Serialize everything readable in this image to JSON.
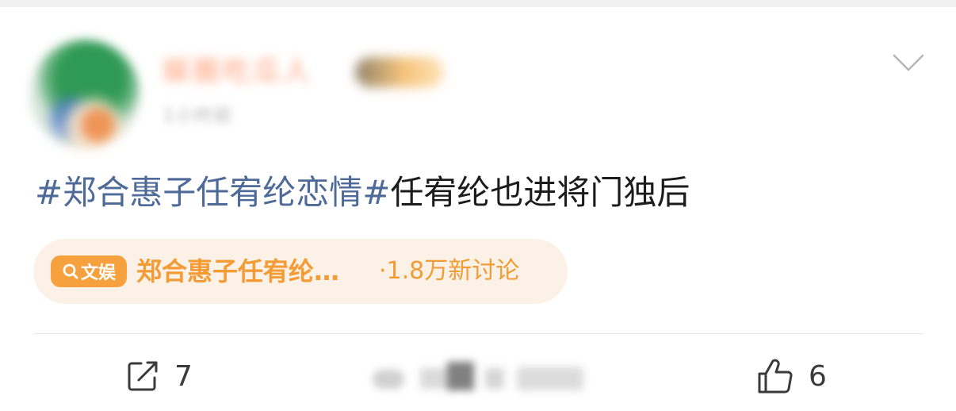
{
  "post": {
    "user": {
      "name": "娱圈吃瓜人",
      "meta": "1小时前"
    },
    "hashtag": "#郑合惠子任宥纶恋情#",
    "text": "任宥纶也进将门独后",
    "topic": {
      "tag_label": "文娱",
      "title": "郑合惠子任宥纶…",
      "count": "·1.8万新讨论"
    },
    "actions": {
      "share_count": "7",
      "like_count": "6"
    }
  },
  "colors": {
    "hashtag": "#4d6a98",
    "topic_accent": "#f39b35",
    "topic_bg": "#fcf1e6"
  },
  "icons": [
    "chevron-down-icon",
    "search-icon",
    "share-icon",
    "like-icon"
  ]
}
